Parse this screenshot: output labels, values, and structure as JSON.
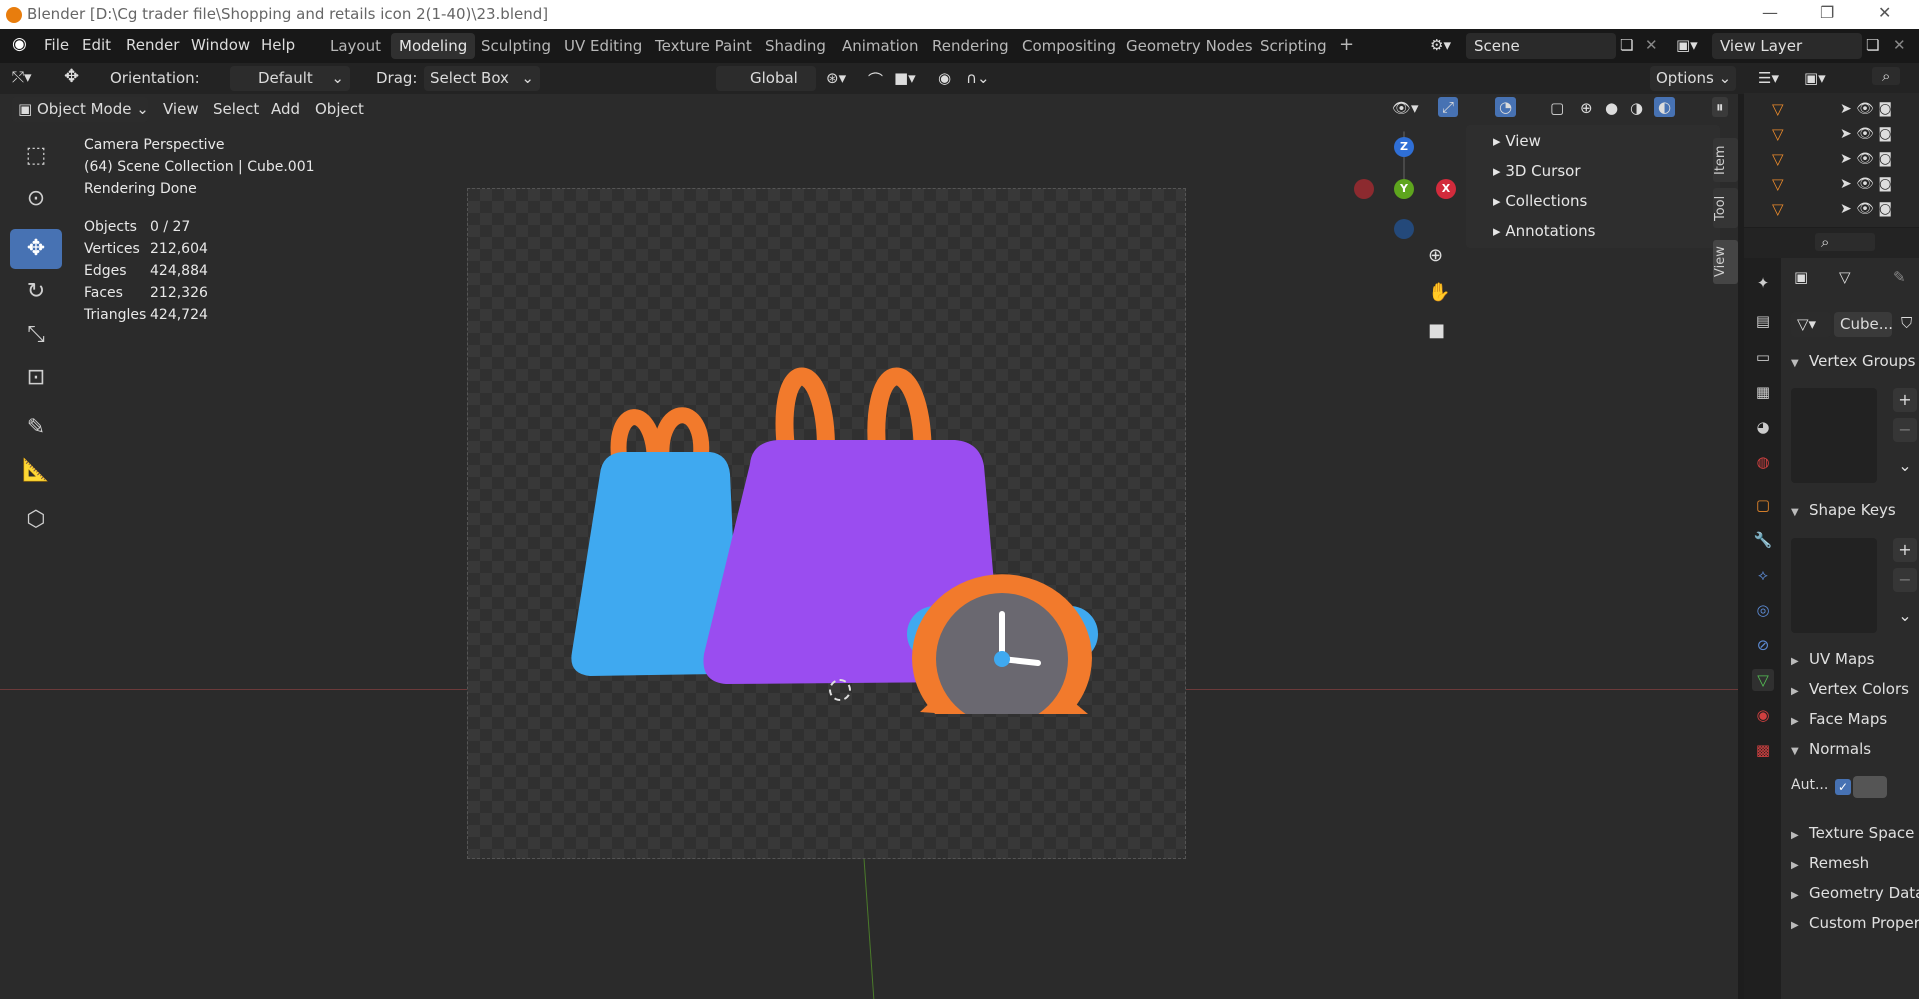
{
  "titlebar": {
    "title": "Blender [D:\\Cg trader file\\Shopping and retails icon 2(1-40)\\23.blend]"
  },
  "menu": [
    "File",
    "Edit",
    "Render",
    "Window",
    "Help"
  ],
  "workspaces": [
    "Layout",
    "Modeling",
    "Sculpting",
    "UV Editing",
    "Texture Paint",
    "Shading",
    "Animation",
    "Rendering",
    "Compositing",
    "Geometry Nodes",
    "Scripting"
  ],
  "active_workspace": "Modeling",
  "scene": {
    "name": "Scene",
    "view_layer": "View Layer"
  },
  "toolheader": {
    "orientation_label": "Orientation:",
    "orientation_value": "Default",
    "drag_label": "Drag:",
    "drag_value": "Select Box",
    "transform_orientation": "Global",
    "options": "Options"
  },
  "viewheader": {
    "mode": "Object Mode",
    "items": [
      "View",
      "Select",
      "Add",
      "Object"
    ]
  },
  "overlay": {
    "line1": "Camera Perspective",
    "line2": "(64) Scene Collection | Cube.001",
    "line3": "Rendering Done"
  },
  "stats": [
    {
      "label": "Objects",
      "value": "0 / 27"
    },
    {
      "label": "Vertices",
      "value": "212,604"
    },
    {
      "label": "Edges",
      "value": "424,884"
    },
    {
      "label": "Faces",
      "value": "212,326"
    },
    {
      "label": "Triangles",
      "value": "424,724"
    }
  ],
  "npanel": {
    "items": [
      "View",
      "3D Cursor",
      "Collections",
      "Annotations"
    ],
    "tabs": [
      "Item",
      "Tool",
      "View"
    ]
  },
  "gizmo": {
    "x": "X",
    "y": "Y",
    "z": "Z"
  },
  "properties": {
    "object_name": "Cube...",
    "sections": [
      "Vertex Groups",
      "Shape Keys",
      "UV Maps",
      "Vertex Colors",
      "Face Maps",
      "Normals",
      "Texture Space",
      "Remesh",
      "Geometry Data",
      "Custom Properties"
    ],
    "auto_smooth_label": "Aut..."
  },
  "colors": {
    "accent": "#4772b3",
    "bag_blue": "#3fa9f0",
    "bag_purple": "#9a4df0",
    "orange": "#f27a2c"
  }
}
